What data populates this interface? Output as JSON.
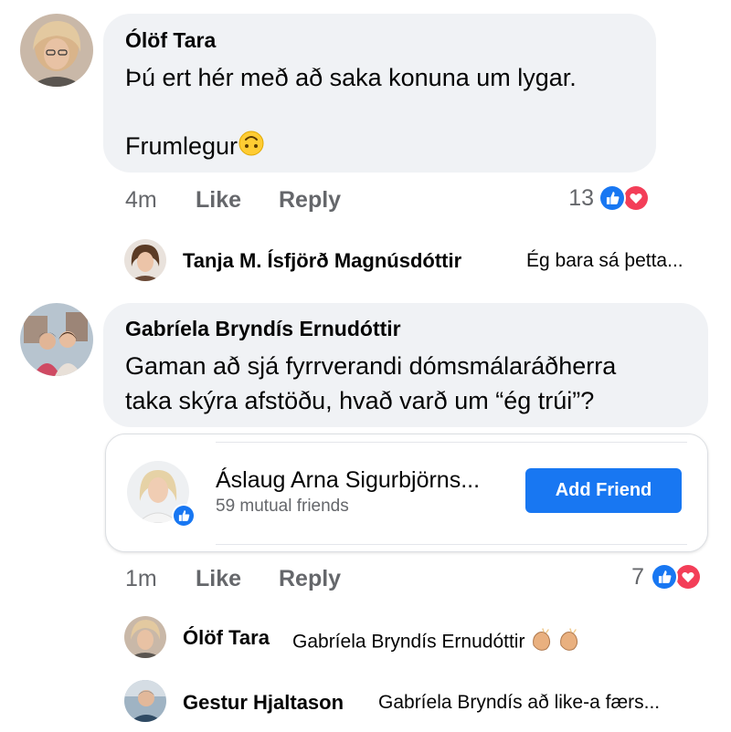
{
  "comments": [
    {
      "author": "Ólöf Tara",
      "line1": "Þú ert hér með að saka konuna um lygar.",
      "line2": "Frumlegur",
      "line2_emoji": "upside-down-face",
      "time": "4m",
      "like_label": "Like",
      "reply_label": "Reply",
      "reaction_count": "13",
      "reactions": [
        "like-icon",
        "love-icon"
      ]
    },
    {
      "author": "Gabríela Bryndís Ernudóttir",
      "line1": "Gaman að sjá fyrrverandi dómsmálaráðherra",
      "line2": "taka skýra afstöðu, hvað varð um “ég trúi”?",
      "time": "1m",
      "like_label": "Like",
      "reply_label": "Reply",
      "reaction_count": "7",
      "reactions": [
        "like-icon",
        "love-icon"
      ]
    }
  ],
  "replies_first": [
    {
      "name": "Tanja M. Ísfjörð Magnúsdóttir",
      "text": "Ég bara sá þetta..."
    }
  ],
  "profile_card": {
    "name": "Áslaug Arna Sigurbjörns...",
    "mutual": "59 mutual friends",
    "button": "Add Friend",
    "badge": "like-icon"
  },
  "replies_second": [
    {
      "name": "Ólöf Tara",
      "text": "Gabríela Bryndís Ernudóttir",
      "emoji": "clapping-hands"
    },
    {
      "name": "Gestur Hjaltason",
      "text": "Gabríela Bryndís að like-a færs..."
    }
  ],
  "colors": {
    "bubble": "#f0f2f5",
    "secondary_text": "#65676b",
    "like_blue": "#1877f2",
    "love_red": "#f33e58"
  }
}
